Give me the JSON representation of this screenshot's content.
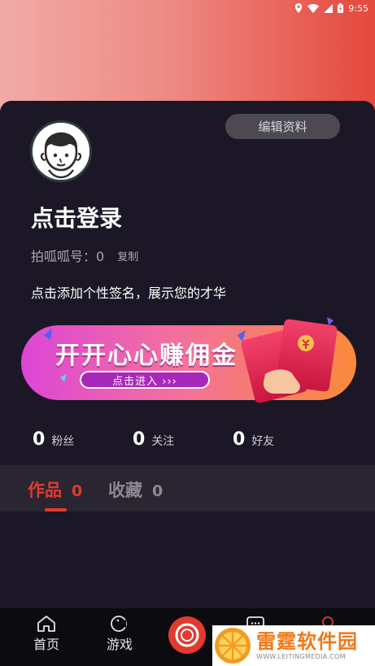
{
  "status_bar": {
    "time": "9:55",
    "icons": [
      "location-icon",
      "wifi-icon",
      "signal-icon",
      "battery-icon"
    ]
  },
  "profile": {
    "edit_label": "编辑资料",
    "login_title": "点击登录",
    "id_label": "拍呱呱号：0",
    "copy_label": "复制",
    "signature": "点击添加个性签名，展示您的才华"
  },
  "banner": {
    "title": "开开心心赚佣金",
    "cta": "点击进入 ›››",
    "accent": "#e13b30",
    "icon": "red-envelope-icon"
  },
  "stats": [
    {
      "value": "0",
      "label": "粉丝"
    },
    {
      "value": "0",
      "label": "关注"
    },
    {
      "value": "0",
      "label": "好友"
    }
  ],
  "tabs": [
    {
      "label": "作品",
      "count": "0",
      "active": true
    },
    {
      "label": "收藏",
      "count": "0",
      "active": false
    }
  ],
  "nav": [
    {
      "label": "首页",
      "icon": "home-icon"
    },
    {
      "label": "游戏",
      "icon": "game-icon"
    },
    {
      "label": "",
      "icon": "camera-icon"
    },
    {
      "label": "",
      "icon": "message-icon"
    },
    {
      "label": "",
      "icon": "profile-icon"
    }
  ],
  "watermark": {
    "title": "雷霆软件园",
    "url": "WWW.LEITINGMEDIA.COM"
  },
  "colors": {
    "accent": "#e13b30",
    "background": "#1c1726",
    "header_gradient_start": "#f2aaa7",
    "header_gradient_end": "#e5483c"
  }
}
